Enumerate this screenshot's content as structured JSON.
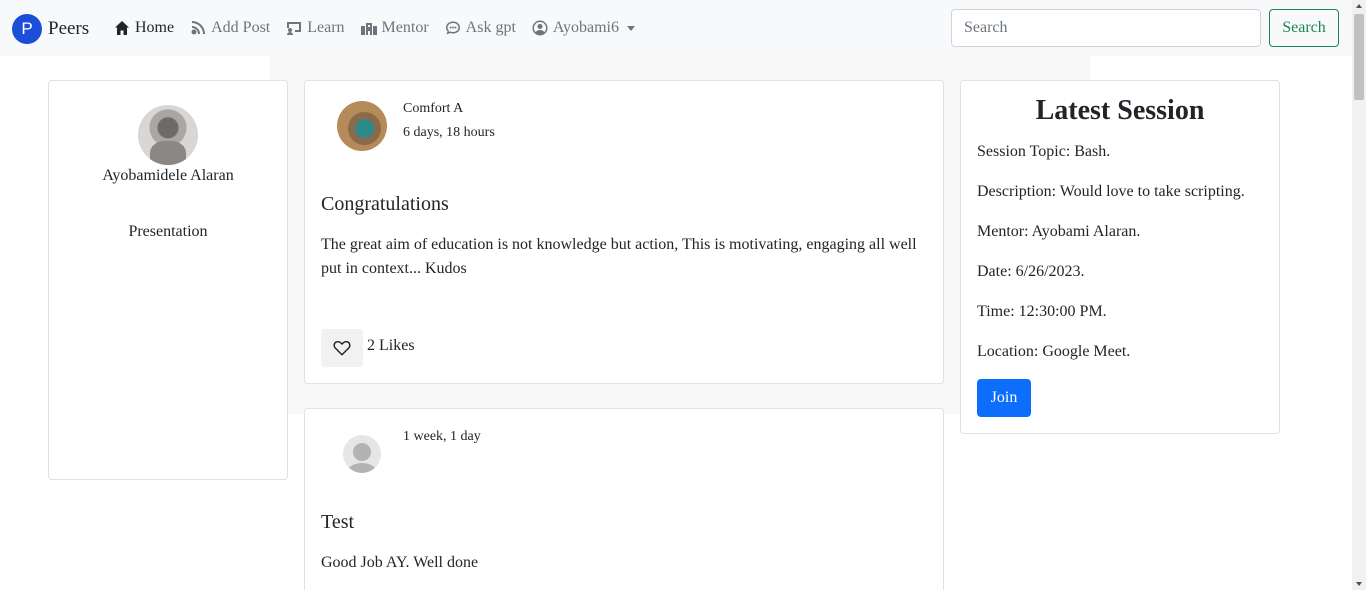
{
  "navbar": {
    "brand_logo": "P",
    "brand_name": "Peers",
    "links": [
      {
        "label": "Home",
        "icon": "home-icon"
      },
      {
        "label": "Add Post",
        "icon": "blog-icon"
      },
      {
        "label": "Learn",
        "icon": "chalkboard-icon"
      },
      {
        "label": "Mentor",
        "icon": "school-icon"
      },
      {
        "label": "Ask gpt",
        "icon": "chat-icon"
      },
      {
        "label": "Ayobami6",
        "icon": "user-circle-icon"
      }
    ],
    "search_placeholder": "Search",
    "search_button": "Search"
  },
  "profile": {
    "name": "Ayobamidele Alaran",
    "link": "Presentation"
  },
  "posts": [
    {
      "author": "Comfort A",
      "time": "6 days, 18 hours",
      "title": "Congratulations",
      "body": "The great aim of education is not knowledge but action, This is motivating, engaging all well put in context... Kudos",
      "likes": "2 Likes"
    },
    {
      "author": "",
      "time": "1 week, 1 day",
      "title": "Test",
      "body": "Good Job AY. Well done"
    }
  ],
  "session": {
    "title": "Latest Session",
    "topic": "Session Topic: Bash.",
    "description": "Description: Would love to take scripting.",
    "mentor": "Mentor: Ayobami Alaran.",
    "date": "Date: 6/26/2023.",
    "time": "Time: 12:30:00 PM.",
    "location": "Location: Google Meet.",
    "join_label": "Join"
  },
  "colors": {
    "brand": "#1d4ed8",
    "search_outline": "#198754",
    "join_button": "#0d6efd",
    "navbar_bg": "#f8f9fa"
  }
}
